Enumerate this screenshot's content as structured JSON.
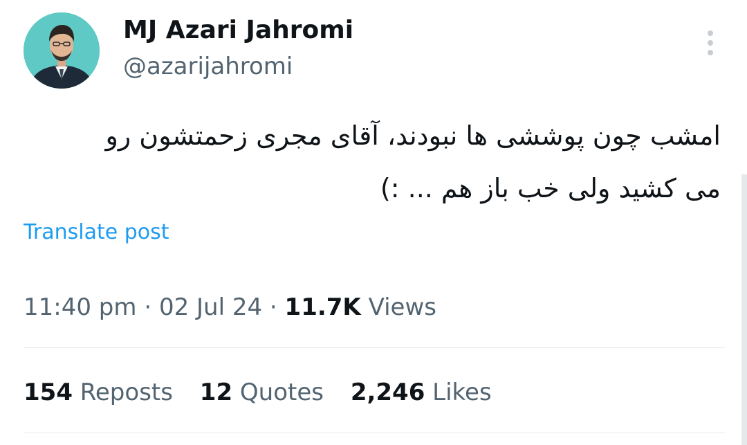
{
  "author": {
    "display_name": "MJ Azari Jahromi",
    "handle": "@azarijahromi",
    "avatar_icon": "profile-photo"
  },
  "more_icon": "more-vertical-icon",
  "tweet": {
    "lines": [
      "امشب چون پوششی ها نبودند، آقای مجری زحمتشون رو",
      "می کشید ولی خب باز هم ... :)"
    ],
    "translate_label": "Translate post"
  },
  "meta": {
    "time": "11:40 pm",
    "sep1": "·",
    "date": "02 Jul 24",
    "sep2": "·",
    "views_count": "11.7K",
    "views_label": "Views"
  },
  "stats": {
    "reposts_count": "154",
    "reposts_label": "Reposts",
    "quotes_count": "12",
    "quotes_label": "Quotes",
    "likes_count": "2,246",
    "likes_label": "Likes"
  },
  "colors": {
    "text_primary": "#0f1419",
    "text_secondary": "#536471",
    "link": "#1d9bf0",
    "divider": "#e4e8eb",
    "avatar_bg": "#5fc9c6"
  }
}
